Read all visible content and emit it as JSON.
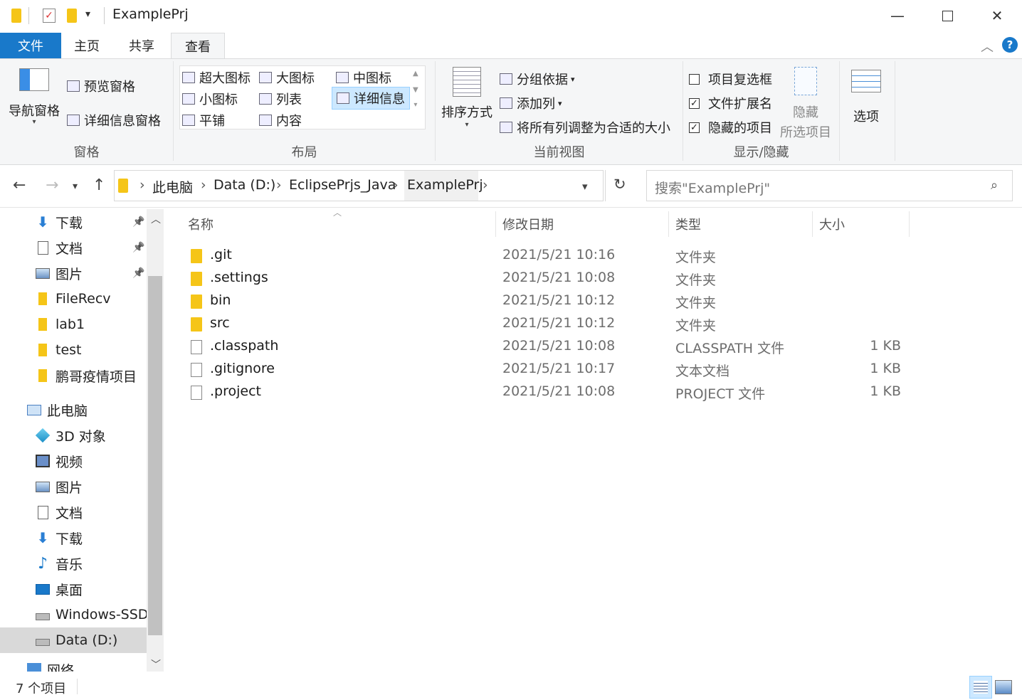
{
  "window": {
    "title": "ExamplePrj"
  },
  "tabs": {
    "file": "文件",
    "home": "主页",
    "share": "共享",
    "view": "查看"
  },
  "ribbon": {
    "panes": {
      "nav": "导航窗格",
      "preview": "预览窗格",
      "details": "详细信息窗格",
      "label": "窗格"
    },
    "layout": {
      "xlarge": "超大图标",
      "large": "大图标",
      "medium": "中图标",
      "small": "小图标",
      "list": "列表",
      "details": "详细信息",
      "tiles": "平铺",
      "content": "内容",
      "label": "布局"
    },
    "current_view": {
      "sort": "排序方式",
      "group": "分组依据",
      "add_col": "添加列",
      "fit_cols": "将所有列调整为合适的大小",
      "label": "当前视图"
    },
    "show_hide": {
      "item_check": "项目复选框",
      "file_ext": "文件扩展名",
      "hidden_items": "隐藏的项目",
      "hide_line1": "隐藏",
      "hide_line2": "所选项目",
      "label": "显示/隐藏"
    },
    "options": "选项",
    "checks": {
      "item_check": false,
      "file_ext": true,
      "hidden_items": true
    }
  },
  "address": {
    "crumbs": [
      "此电脑",
      "Data (D:)",
      "EclipsePrjs_Java",
      "ExamplePrj"
    ],
    "search_placeholder": "搜索\"ExamplePrj\""
  },
  "sidebar": {
    "items": [
      {
        "label": "下载",
        "icon": "download-icon",
        "pinned": true
      },
      {
        "label": "文档",
        "icon": "document-icon",
        "pinned": true
      },
      {
        "label": "图片",
        "icon": "picture-icon",
        "pinned": true
      },
      {
        "label": "FileRecv",
        "icon": "folder-icon"
      },
      {
        "label": "lab1",
        "icon": "folder-icon"
      },
      {
        "label": "test",
        "icon": "folder-icon"
      },
      {
        "label": "鹏哥疫情项目",
        "icon": "folder-icon"
      },
      {
        "label": "此电脑",
        "icon": "computer-icon"
      },
      {
        "label": "3D 对象",
        "icon": "cube-icon"
      },
      {
        "label": "视频",
        "icon": "video-icon"
      },
      {
        "label": "图片",
        "icon": "picture-icon"
      },
      {
        "label": "文档",
        "icon": "document-icon"
      },
      {
        "label": "下载",
        "icon": "download-icon"
      },
      {
        "label": "音乐",
        "icon": "music-icon"
      },
      {
        "label": "桌面",
        "icon": "desktop-icon"
      },
      {
        "label": "Windows-SSD (",
        "icon": "drive-icon"
      },
      {
        "label": "Data (D:)",
        "icon": "drive-icon"
      },
      {
        "label": "网络",
        "icon": "network-icon"
      }
    ]
  },
  "columns": {
    "name": "名称",
    "date": "修改日期",
    "type": "类型",
    "size": "大小"
  },
  "files": [
    {
      "name": ".git",
      "date": "2021/5/21 10:16",
      "type": "文件夹",
      "size": "",
      "kind": "folder"
    },
    {
      "name": ".settings",
      "date": "2021/5/21 10:08",
      "type": "文件夹",
      "size": "",
      "kind": "folder"
    },
    {
      "name": "bin",
      "date": "2021/5/21 10:12",
      "type": "文件夹",
      "size": "",
      "kind": "folder"
    },
    {
      "name": "src",
      "date": "2021/5/21 10:12",
      "type": "文件夹",
      "size": "",
      "kind": "folder"
    },
    {
      "name": ".classpath",
      "date": "2021/5/21 10:08",
      "type": "CLASSPATH 文件",
      "size": "1 KB",
      "kind": "doc"
    },
    {
      "name": ".gitignore",
      "date": "2021/5/21 10:17",
      "type": "文本文档",
      "size": "1 KB",
      "kind": "doc"
    },
    {
      "name": ".project",
      "date": "2021/5/21 10:08",
      "type": "PROJECT 文件",
      "size": "1 KB",
      "kind": "doc"
    }
  ],
  "status": {
    "count": "7 个项目"
  },
  "colors": {
    "accent": "#1979ca",
    "folder": "#f5c518",
    "selection": "#cce8ff"
  }
}
